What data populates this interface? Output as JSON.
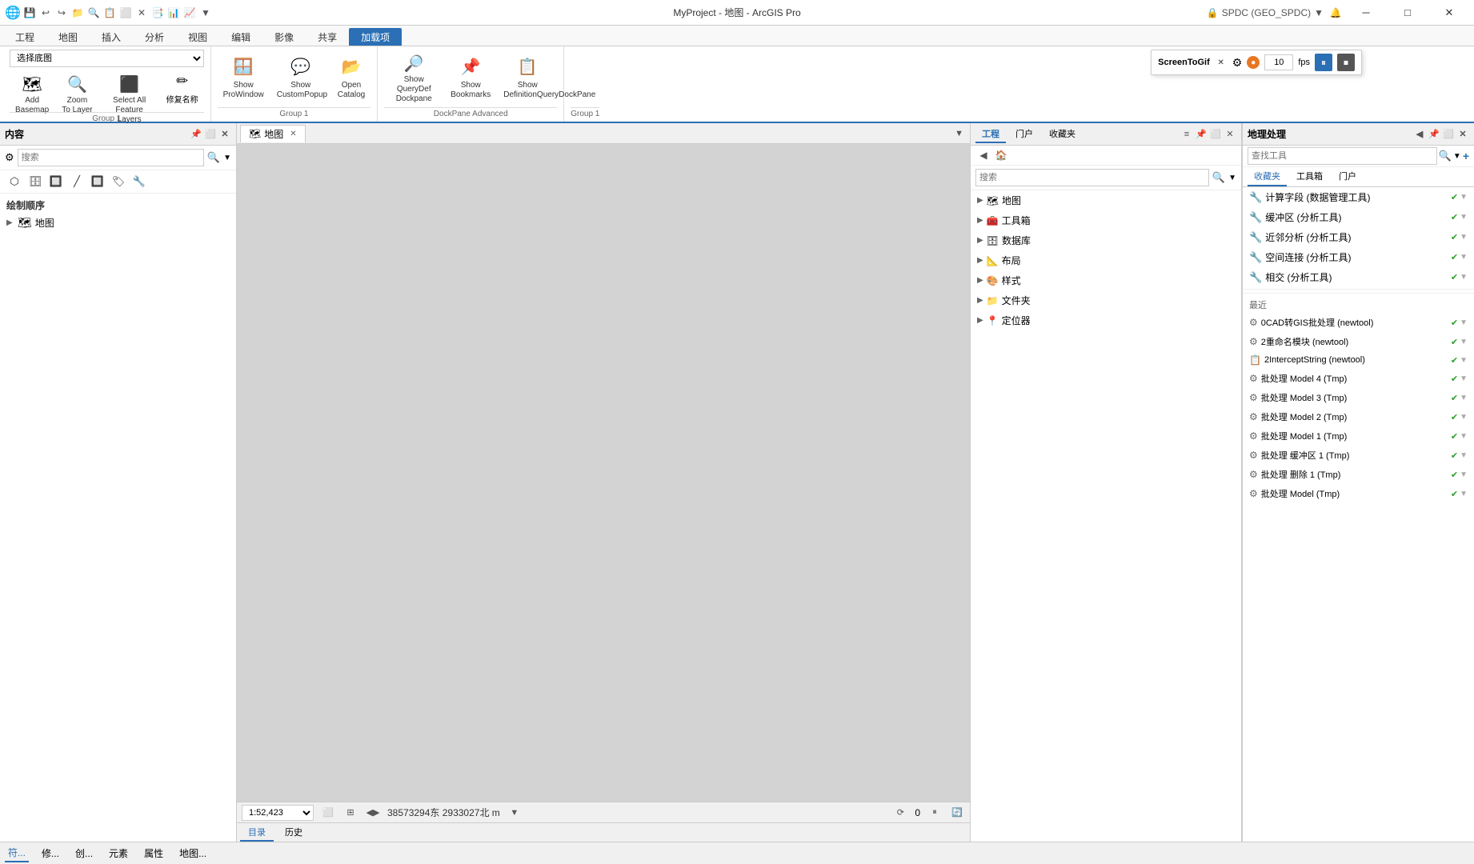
{
  "app": {
    "title": "MyProject - 地图 - ArcGIS Pro",
    "help_btn": "?",
    "min_btn": "─",
    "max_btn": "□",
    "close_btn": "✕"
  },
  "quickaccess": {
    "icons": [
      "💾",
      "🖊",
      "↩",
      "↪",
      "⬛",
      "🔍",
      "📋",
      "⬜",
      "✕",
      "📑",
      "📊",
      "📈",
      "▼"
    ]
  },
  "ribbon_tabs": [
    {
      "label": "工程",
      "active": false
    },
    {
      "label": "地图",
      "active": false
    },
    {
      "label": "插入",
      "active": false
    },
    {
      "label": "分析",
      "active": false
    },
    {
      "label": "视图",
      "active": false
    },
    {
      "label": "编辑",
      "active": false
    },
    {
      "label": "影像",
      "active": false
    },
    {
      "label": "共享",
      "active": false
    },
    {
      "label": "加载项",
      "active": true
    }
  ],
  "ribbon_group1": {
    "label": "Group 1",
    "dropdown_label": "选择底图",
    "items": [
      {
        "label": "Add\nBasemap",
        "icon": "🗺"
      },
      {
        "label": "Zoom\nTo Layer",
        "icon": "🔍"
      },
      {
        "label": "Select All\nFeature Layers",
        "icon": "⬛"
      }
    ],
    "fix_label": "修复名称"
  },
  "ribbon_group2": {
    "label": "Group 1",
    "items": [
      {
        "label": "Show\nProWindow",
        "icon": "🪟"
      },
      {
        "label": "Show\nCustomPopup",
        "icon": "💬"
      },
      {
        "label": "Open\nCatalog",
        "icon": "📂"
      }
    ]
  },
  "ribbon_group3": {
    "label": "DockPane Advanced",
    "items": [
      {
        "label": "Show QueryDef\nDockpane",
        "icon": "🔎"
      },
      {
        "label": "Show\nBookmarks",
        "icon": "📌"
      },
      {
        "label": "Show\nDefinitionQueryDockPane",
        "icon": "📋"
      }
    ]
  },
  "ribbon_group4": {
    "label": "Group 1"
  },
  "screentogif": {
    "title": "ScreenToGif",
    "fps_label": "fps",
    "fps_value": "10"
  },
  "contents_panel": {
    "title": "内容",
    "search_placeholder": "搜索",
    "section_title": "绘制顺序",
    "tree": [
      {
        "label": "地图",
        "icon": "🗺",
        "indent": 0
      }
    ]
  },
  "map_panel": {
    "tab_label": "地图",
    "scale": "1:52,423",
    "coord": "38573294东 2933027北 m",
    "rotation": "0",
    "bottom_tabs": [
      {
        "label": "目录",
        "active": true
      },
      {
        "label": "历史",
        "active": false
      }
    ]
  },
  "catalog_panel": {
    "title": "目录",
    "tabs": [
      {
        "label": "工程",
        "active": true
      },
      {
        "label": "门户",
        "active": false
      },
      {
        "label": "收藏夹",
        "active": false
      }
    ],
    "search_placeholder": "搜索",
    "tree": [
      {
        "label": "地图",
        "icon": "🗺",
        "arrow": true
      },
      {
        "label": "工具箱",
        "icon": "🧰",
        "arrow": true
      },
      {
        "label": "数据库",
        "icon": "🗄",
        "arrow": true
      },
      {
        "label": "布局",
        "icon": "📐",
        "arrow": true
      },
      {
        "label": "样式",
        "icon": "🎨",
        "arrow": true
      },
      {
        "label": "文件夹",
        "icon": "📁",
        "arrow": true
      },
      {
        "label": "定位器",
        "icon": "📍",
        "arrow": true
      }
    ]
  },
  "geo_panel": {
    "title": "地理处理",
    "search_placeholder": "查找工具",
    "tabs": [
      {
        "label": "收藏夹",
        "active": true
      },
      {
        "label": "工具箱",
        "active": false
      },
      {
        "label": "门户",
        "active": false
      }
    ],
    "favorites": [
      {
        "label": "计算字段 (数据管理工具)",
        "icon": "🔧",
        "ok": true,
        "bad": false
      },
      {
        "label": "缓冲区 (分析工具)",
        "icon": "🔧",
        "ok": true,
        "bad": false
      },
      {
        "label": "近邻分析 (分析工具)",
        "icon": "🔧",
        "ok": true,
        "bad": false
      },
      {
        "label": "空间连接 (分析工具)",
        "icon": "🔧",
        "ok": true,
        "bad": false
      },
      {
        "label": "相交 (分析工具)",
        "icon": "🔧",
        "ok": true,
        "bad": false
      }
    ],
    "recent_label": "最近",
    "recent": [
      {
        "label": "0CAD转GIS批处理 (newtool)",
        "icon": "⚙",
        "ok": true,
        "bad": true
      },
      {
        "label": "2重命名模块 (newtool)",
        "icon": "⚙",
        "ok": true,
        "bad": true
      },
      {
        "label": "2InterceptString (newtool)",
        "icon": "📋",
        "ok": true,
        "bad": true
      },
      {
        "label": "批处理 Model 4 (Tmp)",
        "icon": "⚙",
        "ok": true,
        "bad": true
      },
      {
        "label": "批处理 Model 3 (Tmp)",
        "icon": "⚙",
        "ok": true,
        "bad": true
      },
      {
        "label": "批处理 Model 2 (Tmp)",
        "icon": "⚙",
        "ok": true,
        "bad": true
      },
      {
        "label": "批处理 Model 1 (Tmp)",
        "icon": "⚙",
        "ok": true,
        "bad": true
      },
      {
        "label": "批处理 缓冲区 1 (Tmp)",
        "icon": "⚙",
        "ok": true,
        "bad": true
      },
      {
        "label": "批处理 删除 1 (Tmp)",
        "icon": "⚙",
        "ok": true,
        "bad": true
      },
      {
        "label": "批处理 Model (Tmp)",
        "icon": "⚙",
        "ok": true,
        "bad": true
      }
    ]
  },
  "bottom_bar": {
    "tabs": [
      "符...",
      "修...",
      "创...",
      "元素",
      "属性",
      "地图..."
    ]
  }
}
